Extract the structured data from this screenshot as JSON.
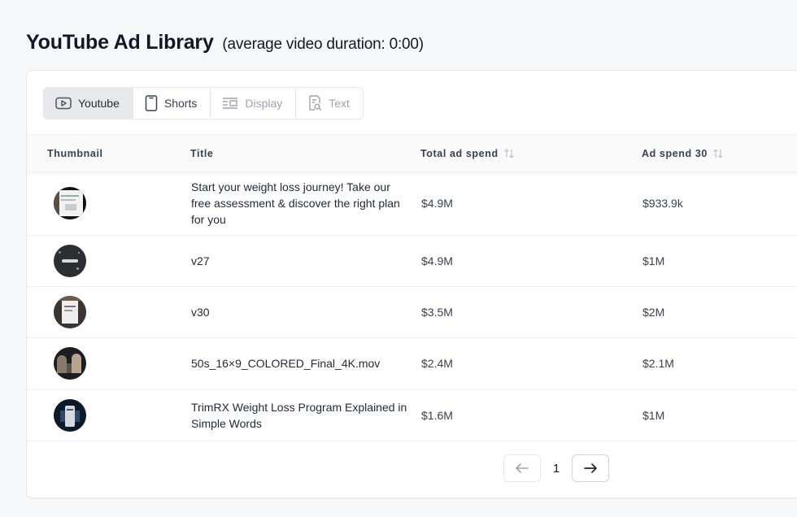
{
  "header": {
    "title": "YouTube Ad Library",
    "subtitle": "(average video duration: 0:00)"
  },
  "tabs": [
    {
      "label": "Youtube",
      "icon": "play-icon",
      "state": "active"
    },
    {
      "label": "Shorts",
      "icon": "phone-icon",
      "state": "normal"
    },
    {
      "label": "Display",
      "icon": "display-layout-icon",
      "state": "disabled"
    },
    {
      "label": "Text",
      "icon": "document-search-icon",
      "state": "disabled"
    }
  ],
  "table": {
    "columns": [
      "Thumbnail",
      "Title",
      "Total ad spend",
      "Ad spend 30"
    ],
    "rows": [
      {
        "title": "Start your weight loss journey! Take our free assessment & discover the right plan for you",
        "total_spend": "$4.9M",
        "spend_30": "$933.9k"
      },
      {
        "title": "v27",
        "total_spend": "$4.9M",
        "spend_30": "$1M"
      },
      {
        "title": "v30",
        "total_spend": "$3.5M",
        "spend_30": "$2M"
      },
      {
        "title": "50s_16×9_COLORED_Final_4K.mov",
        "total_spend": "$2.4M",
        "spend_30": "$2.1M"
      },
      {
        "title": "TrimRX Weight Loss Program Explained in Simple Words",
        "total_spend": "$1.6M",
        "spend_30": "$1M"
      }
    ]
  },
  "pagination": {
    "current_page": "1"
  },
  "colors": {
    "active_tab_bg": "#e8e9ec",
    "border": "#e5e7eb",
    "disabled_text": "#9ca3af"
  }
}
